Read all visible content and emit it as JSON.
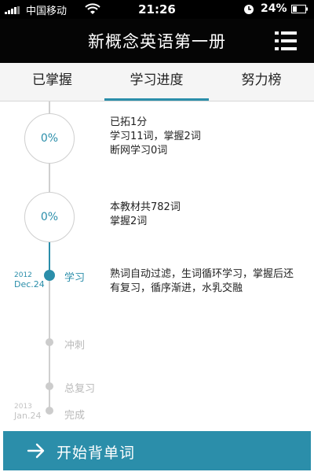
{
  "status_bar": {
    "carrier": "中国移动",
    "time": "21:26",
    "battery": "24%"
  },
  "nav": {
    "title": "新概念英语第一册"
  },
  "tabs": [
    {
      "label": "已掌握"
    },
    {
      "label": "学习进度",
      "active": true
    },
    {
      "label": "努力榜"
    }
  ],
  "progress": [
    {
      "percent_label": "0%",
      "lines": [
        "已拓1分",
        "学习11词，掌握2词",
        "断网学习0词"
      ]
    },
    {
      "percent_label": "0%",
      "lines": [
        "本教材共782词",
        "掌握2词"
      ]
    }
  ],
  "stages": [
    {
      "label": "学习",
      "year": "2012",
      "date": "Dec.24",
      "state": "current"
    },
    {
      "label": "冲刺",
      "state": "future"
    },
    {
      "label": "总复习",
      "state": "future"
    },
    {
      "label": "完成",
      "year": "2013",
      "date": "Jan.24",
      "state": "future"
    }
  ],
  "stage_description": "熟词自动过滤，生词循环学习，掌握后还有复习，循序渐进，水乳交融",
  "start_button": {
    "label": "开始背单词"
  },
  "colors": {
    "accent": "#2b8eaa",
    "nav_bg": "#050505",
    "tabs_bg": "#f5f5f5"
  },
  "icons": {
    "menu": "list-menu-icon",
    "start": "arrow-right-icon",
    "wifi": "wifi-icon",
    "clock": "clock-icon",
    "battery": "battery-icon",
    "signal": "signal-icon"
  }
}
